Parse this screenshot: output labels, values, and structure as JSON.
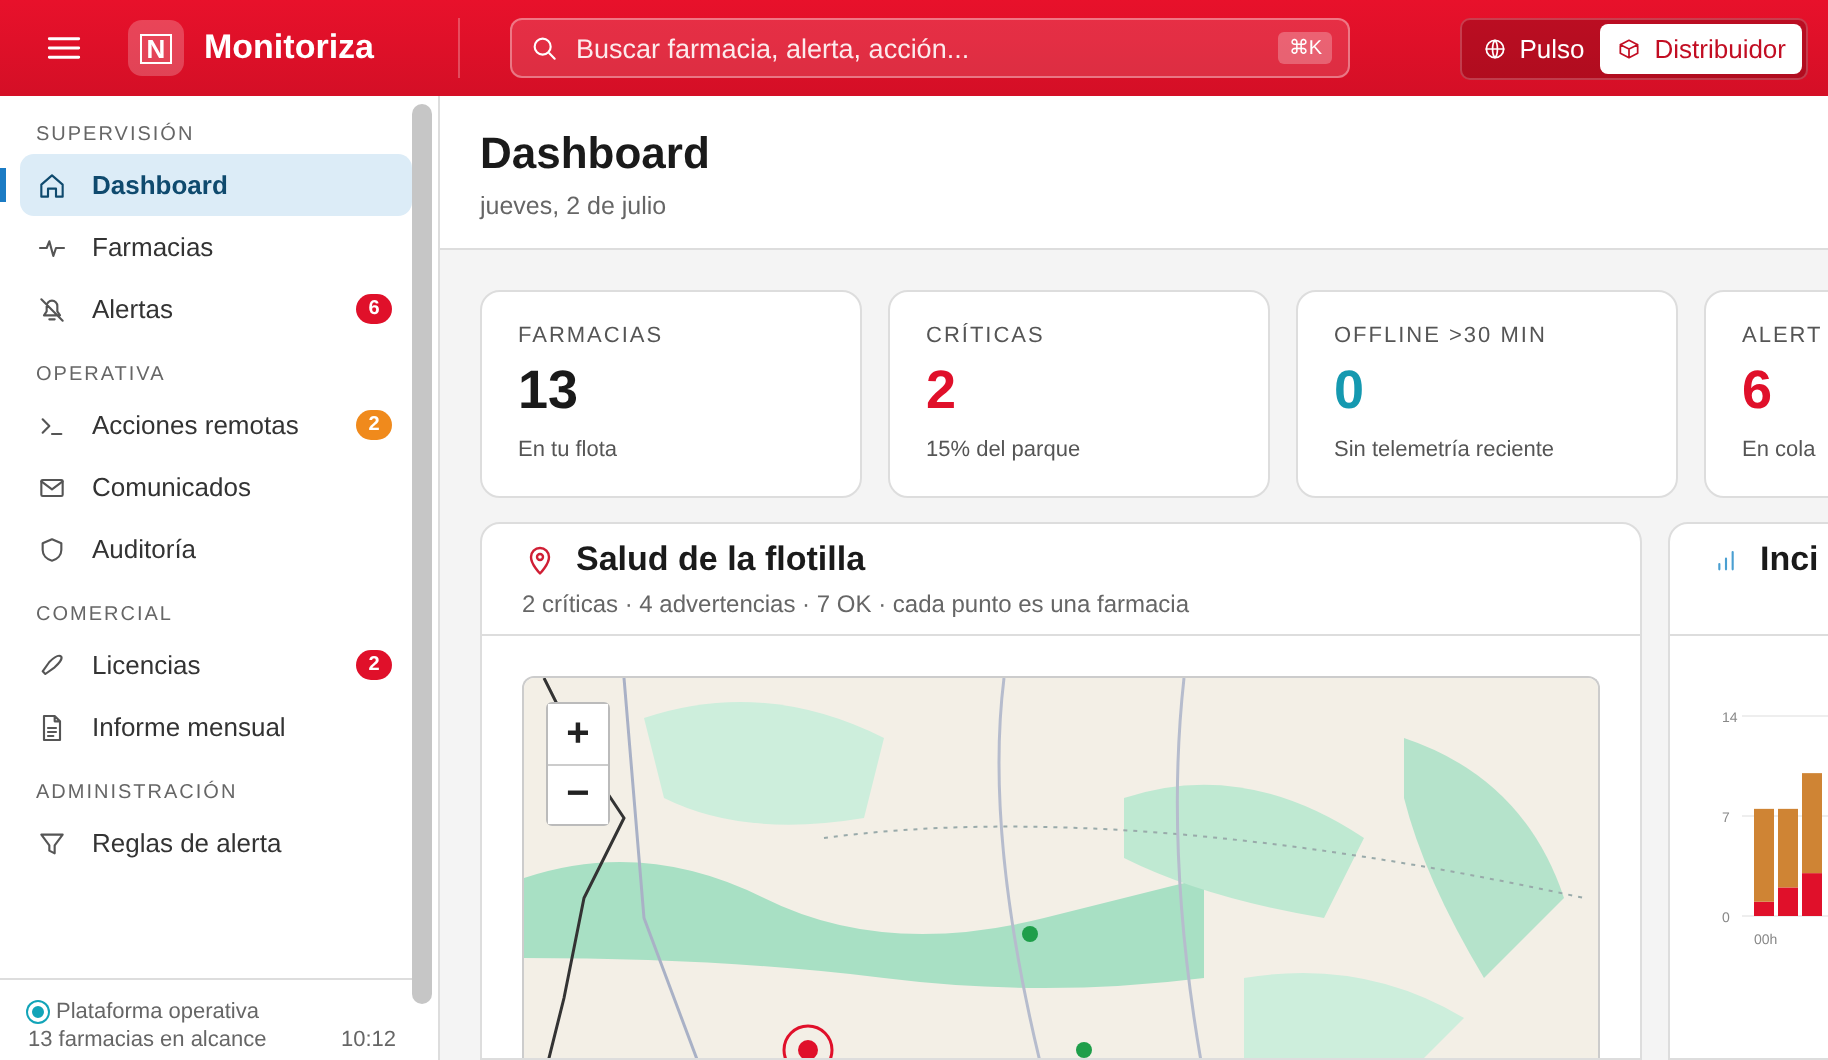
{
  "topbar": {
    "app_name": "Monitoriza",
    "logo_letter": "N",
    "search": {
      "placeholder": "Buscar farmacia, alerta, acción...",
      "shortcut": "⌘K"
    },
    "modes": [
      {
        "label": "Pulso",
        "selected": false
      },
      {
        "label": "Distribuidor",
        "selected": true
      }
    ]
  },
  "sidebar": {
    "sections": [
      {
        "title": "SUPERVISIÓN",
        "items": [
          {
            "label": "Dashboard",
            "selected": true
          },
          {
            "label": "Farmacias",
            "selected": false
          },
          {
            "label": "Alertas",
            "selected": false,
            "badge": {
              "text": "6",
              "color": "#e0102a"
            }
          }
        ]
      },
      {
        "title": "OPERATIVA",
        "items": [
          {
            "label": "Acciones remotas",
            "selected": false,
            "badge": {
              "text": "2",
              "color": "#f08a1c"
            }
          },
          {
            "label": "Comunicados",
            "selected": false
          },
          {
            "label": "Auditoría",
            "selected": false
          }
        ]
      },
      {
        "title": "COMERCIAL",
        "items": [
          {
            "label": "Licencias",
            "selected": false,
            "badge": {
              "text": "2",
              "color": "#e0102a"
            }
          },
          {
            "label": "Informe mensual",
            "selected": false
          }
        ]
      },
      {
        "title": "ADMINISTRACIÓN",
        "items": [
          {
            "label": "Reglas de alerta",
            "selected": false
          }
        ]
      }
    ],
    "footer": {
      "status": "Plataforma operativa",
      "scope": "13 farmacias en alcance",
      "time": "10:12"
    }
  },
  "page": {
    "title": "Dashboard",
    "date": "jueves, 2 de julio"
  },
  "stats": [
    {
      "label": "FARMACIAS",
      "value": "13",
      "note": "En tu flota",
      "color": "#1a1a1a"
    },
    {
      "label": "CRÍTICAS",
      "value": "2",
      "note": "15% del parque",
      "color": "#e0102a"
    },
    {
      "label": "OFFLINE >30 MIN",
      "value": "0",
      "note": "Sin telemetría reciente",
      "color": "#1599b0"
    },
    {
      "label": "ALERT",
      "value": "6",
      "note": "En cola",
      "color": "#e0102a"
    }
  ],
  "fleet": {
    "title": "Salud de la flotilla",
    "summary": "2 críticas · 4 advertencias · 7 OK · cada punto es una farmacia",
    "zoom_controls": [
      "+",
      "−"
    ]
  },
  "incidents": {
    "title": "Inci",
    "chart_data": {
      "type": "bar",
      "stacked": true,
      "categories": [
        "00h",
        null,
        null
      ],
      "yticks": [
        0,
        7,
        14
      ],
      "ylim": [
        0,
        14
      ],
      "series": [
        {
          "color": "#e0102a",
          "values": [
            1,
            2,
            3
          ]
        },
        {
          "color": "#cf8434",
          "values": [
            6.5,
            5.5,
            7
          ]
        }
      ]
    }
  }
}
